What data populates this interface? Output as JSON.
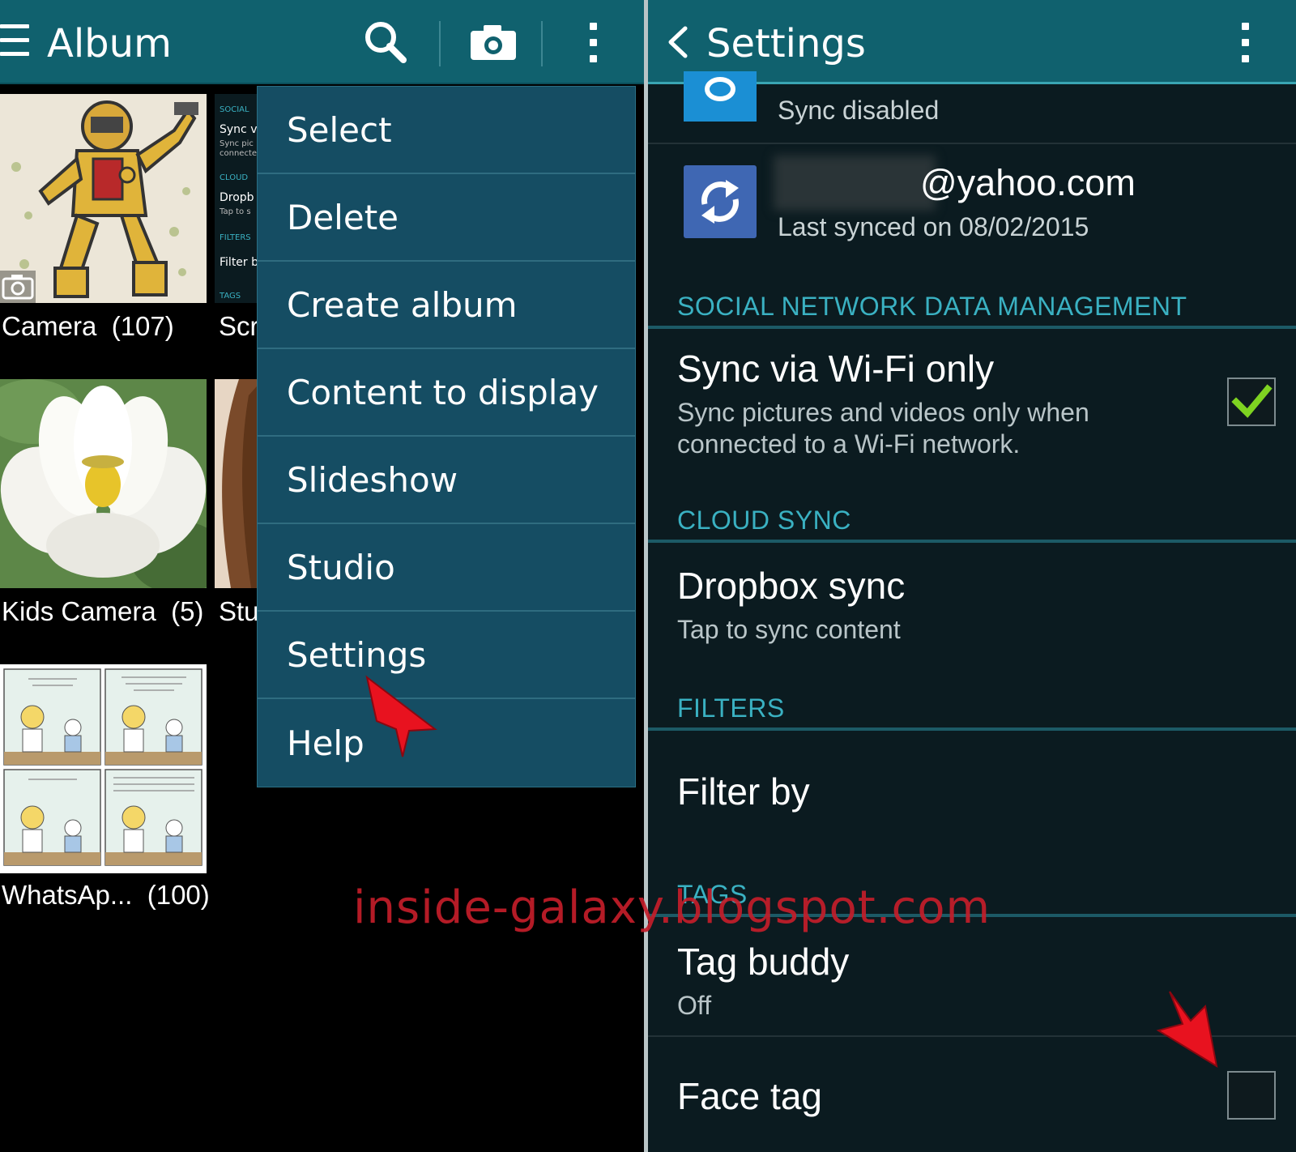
{
  "left": {
    "title": "Album",
    "albums": [
      {
        "name": "Camera",
        "count": "(107)"
      },
      {
        "name": "Scr",
        "count": ""
      },
      {
        "name": "Kids Camera",
        "count": "(5)"
      },
      {
        "name": "Stu",
        "count": ""
      },
      {
        "name": "WhatsAp...",
        "count": "(100)"
      }
    ],
    "peek": {
      "social": "SOCIAL",
      "sync": "Sync v",
      "sync_sub1": "Sync pic",
      "sync_sub2": "connecte",
      "cloud": "CLOUD",
      "dropbox": "Dropb",
      "dropbox_sub": "Tap to s",
      "filters": "FILTERS",
      "filter": "Filter b",
      "tags": "TAGS"
    },
    "menu": [
      "Select",
      "Delete",
      "Create album",
      "Content to display",
      "Slideshow",
      "Studio",
      "Settings",
      "Help"
    ]
  },
  "right": {
    "title": "Settings",
    "account1": {
      "sub": "Sync disabled"
    },
    "account2": {
      "name": "@yahoo.com",
      "sub": "Last synced on 08/02/2015"
    },
    "sections": {
      "social": "SOCIAL NETWORK DATA MANAGEMENT",
      "cloud": "CLOUD SYNC",
      "filters": "FILTERS",
      "tags": "TAGS"
    },
    "prefs": {
      "wifi_title": "Sync via Wi-Fi only",
      "wifi_sub": "Sync pictures and videos only when connected to a Wi-Fi network.",
      "dropbox_title": "Dropbox sync",
      "dropbox_sub": "Tap to sync content",
      "filter_title": "Filter by",
      "tagbuddy_title": "Tag buddy",
      "tagbuddy_sub": "Off",
      "facetag_title": "Face tag"
    },
    "wifi_checked": true,
    "facetag_checked": false
  },
  "watermark": "inside-galaxy.blogspot.com",
  "colors": {
    "actionbar": "#10616e",
    "accent": "#3ab1c2",
    "menu": "#154d63",
    "check": "#7ed321",
    "arrow": "#e8121f"
  }
}
